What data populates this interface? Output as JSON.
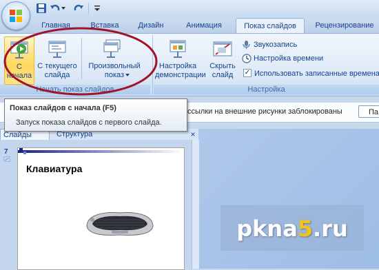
{
  "quick_access": {
    "icons": [
      "office-button-icon",
      "save-icon",
      "undo-icon",
      "redo-icon",
      "customize-icon"
    ]
  },
  "tabs": [
    {
      "label": "Главная"
    },
    {
      "label": "Вставка"
    },
    {
      "label": "Дизайн"
    },
    {
      "label": "Анимация"
    },
    {
      "label": "Показ слайдов",
      "active": true
    },
    {
      "label": "Рецензирование"
    }
  ],
  "ribbon": {
    "group_start": {
      "label": "Начать показ слайдов",
      "buttons": [
        {
          "line1": "С",
          "line2": "начала"
        },
        {
          "line1": "С текущего",
          "line2": "слайда"
        },
        {
          "line1": "Произвольный",
          "line2": "показ"
        }
      ]
    },
    "group_setup": {
      "label": "Настройка",
      "buttons": [
        {
          "line1": "Настройка",
          "line2": "демонстрации"
        },
        {
          "line1": "Скрыть",
          "line2": "слайд"
        }
      ],
      "commands": [
        {
          "label": "Звукозапись"
        },
        {
          "label": "Настройка времени"
        },
        {
          "label": "Использовать записанные времена",
          "checked": true
        }
      ],
      "checked_glyph": "✓"
    }
  },
  "message_bar": {
    "text": "ссылки на внешние рисунки заблокированы",
    "button": "Па"
  },
  "tooltip": {
    "title": "Показ слайдов с начала (F5)",
    "description": "Запуск показа слайдов с первого слайда."
  },
  "pane_tabs": {
    "slides": "Слайды",
    "outline": "Структура",
    "close_glyph": "×"
  },
  "slide": {
    "number": "7",
    "title": "Клавиатура"
  },
  "watermark": {
    "prefix": "pkna",
    "digit": "5",
    "suffix": ".ru"
  },
  "colors": {
    "accent": "#15428b",
    "annotation_ellipse": "#a0132a",
    "tab_active_bg": "#eaf1fb",
    "watermark_digit": "#f0c419"
  }
}
